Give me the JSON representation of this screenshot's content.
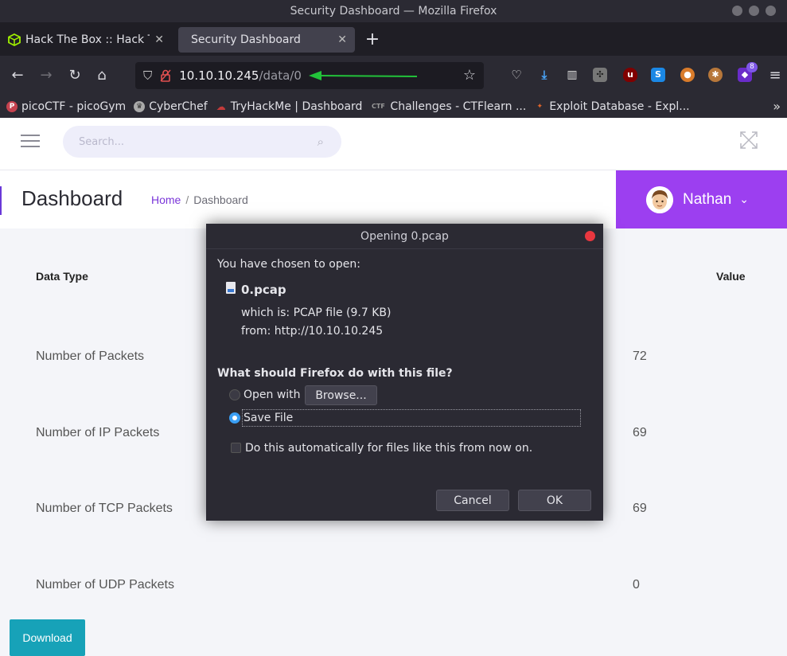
{
  "window": {
    "title": "Security Dashboard — Mozilla Firefox"
  },
  "tabs": [
    {
      "label": "Hack The Box :: Hack The",
      "icon": "hackthebox-icon"
    },
    {
      "label": "Security Dashboard",
      "icon": ""
    }
  ],
  "urlbar": {
    "host": "10.10.10.245",
    "path": "/data/0"
  },
  "extensions": {
    "badge_count": "8"
  },
  "bookmarks": [
    {
      "label": "picoCTF - picoGym",
      "color": "#c6424f"
    },
    {
      "label": "CyberChef",
      "color": "#aaaaaa"
    },
    {
      "label": "TryHackMe | Dashboard",
      "color": "#c43b3b"
    },
    {
      "label": "Challenges - CTFlearn ...",
      "color": "#555555"
    },
    {
      "label": "Exploit Database - Expl...",
      "color": "#e0642a"
    }
  ],
  "search": {
    "placeholder": "Search..."
  },
  "header": {
    "title": "Dashboard",
    "breadcrumb_home": "Home",
    "breadcrumb_sep": "/",
    "breadcrumb_current": "Dashboard",
    "user_name": "Nathan"
  },
  "table": {
    "headers": {
      "type": "Data Type",
      "value": "Value"
    },
    "rows": [
      {
        "label": "Number of Packets",
        "value": "72"
      },
      {
        "label": "Number of IP Packets",
        "value": "69"
      },
      {
        "label": "Number of TCP Packets",
        "value": "69"
      },
      {
        "label": "Number of UDP Packets",
        "value": "0"
      }
    ]
  },
  "download_label": "Download",
  "dialog": {
    "title": "Opening 0.pcap",
    "intro": "You have chosen to open:",
    "file_name": "0.pcap",
    "which_is": "which is:  PCAP file (9.7 KB)",
    "from": "from:  http://10.10.10.245",
    "question": "What should Firefox do with this file?",
    "open_with_label": "Open with",
    "browse_label": "Browse...",
    "save_file_label": "Save File",
    "auto_label": "Do this automatically for files like this from now on.",
    "cancel_label": "Cancel",
    "ok_label": "OK"
  },
  "colors": {
    "accent_purple": "#9c3ff0",
    "download_teal": "#17a2b8",
    "arrow_green": "#22c23a"
  }
}
